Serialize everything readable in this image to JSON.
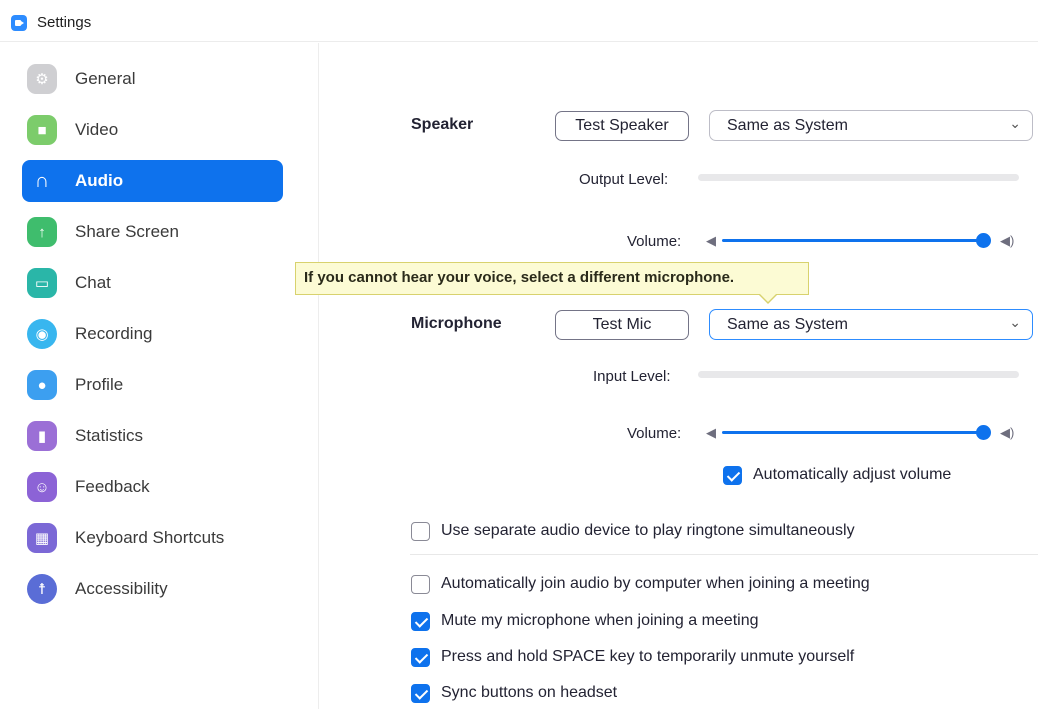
{
  "window": {
    "title": "Settings"
  },
  "sidebar": {
    "items": [
      {
        "label": "General",
        "icon": "gear-icon",
        "color": "#cccccc",
        "glyph": "⚙"
      },
      {
        "label": "Video",
        "icon": "video-camera-icon",
        "color": "#7ccc6b",
        "glyph": "■"
      },
      {
        "label": "Audio",
        "icon": "headphones-icon",
        "color": "#0e72ed",
        "glyph": "∩",
        "active": true
      },
      {
        "label": "Share Screen",
        "icon": "share-screen-icon",
        "color": "#3fbd6d",
        "glyph": "↑"
      },
      {
        "label": "Chat",
        "icon": "chat-icon",
        "color": "#2ab6a8",
        "glyph": "▭"
      },
      {
        "label": "Recording",
        "icon": "recording-icon",
        "color": "#38b6ef",
        "glyph": "◉"
      },
      {
        "label": "Profile",
        "icon": "profile-icon",
        "color": "#3c9ff0",
        "glyph": "●"
      },
      {
        "label": "Statistics",
        "icon": "statistics-icon",
        "color": "#9b6fd6",
        "glyph": "▮"
      },
      {
        "label": "Feedback",
        "icon": "feedback-icon",
        "color": "#8c63d6",
        "glyph": "☺"
      },
      {
        "label": "Keyboard Shortcuts",
        "icon": "keyboard-icon",
        "color": "#7b68d6",
        "glyph": "▦"
      },
      {
        "label": "Accessibility",
        "icon": "accessibility-icon",
        "color": "#5a6dd6",
        "glyph": "☨"
      }
    ]
  },
  "speaker": {
    "label": "Speaker",
    "test_button": "Test Speaker",
    "device": "Same as System",
    "output_level_label": "Output Level:",
    "volume_label": "Volume:",
    "volume_level": 1.0
  },
  "tooltip": {
    "text": "If you cannot hear your voice, select a different microphone."
  },
  "microphone": {
    "label": "Microphone",
    "test_button": "Test Mic",
    "device": "Same as System",
    "input_level_label": "Input Level:",
    "volume_label": "Volume:",
    "volume_level": 1.0,
    "auto_adjust_label": "Automatically adjust volume",
    "auto_adjust_checked": true
  },
  "options": {
    "separate_ringtone": {
      "label": "Use separate audio device to play ringtone simultaneously",
      "checked": false
    },
    "auto_join": {
      "label": "Automatically join audio by computer when joining a meeting",
      "checked": false
    },
    "mute_on_join": {
      "label": "Mute my microphone when joining a meeting",
      "checked": true
    },
    "space_unmute": {
      "label": "Press and hold SPACE key to temporarily unmute yourself",
      "checked": true
    },
    "sync_headset": {
      "label": "Sync buttons on headset",
      "checked": true
    }
  },
  "colors": {
    "accent": "#0e72ed",
    "tooltip_bg": "#fcfbd4"
  }
}
